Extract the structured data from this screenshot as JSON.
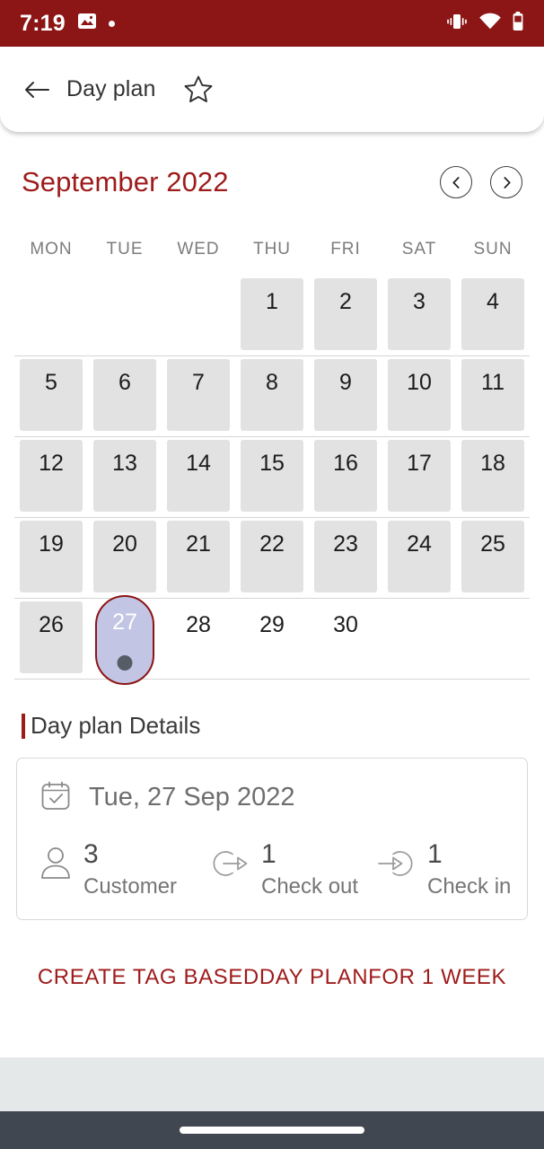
{
  "status_bar": {
    "time": "7:19",
    "icons": [
      "image-icon",
      "notification-dot",
      "vibrate-icon",
      "wifi-icon",
      "battery-icon"
    ],
    "background_color": "#8C1515"
  },
  "app_bar": {
    "back_icon": "arrow-left-icon",
    "title": "Day plan",
    "star_icon": "star-outline-icon"
  },
  "calendar": {
    "month_title": "September 2022",
    "prev_icon": "chevron-left-icon",
    "next_icon": "chevron-right-icon",
    "weekdays": [
      "MON",
      "TUE",
      "WED",
      "THU",
      "FRI",
      "SAT",
      "SUN"
    ],
    "accent_color": "#9E1B1B",
    "selected_day": 27,
    "weeks": [
      [
        {
          "day": "",
          "state": "blank"
        },
        {
          "day": "",
          "state": "blank"
        },
        {
          "day": "",
          "state": "blank"
        },
        {
          "day": "1",
          "state": "past"
        },
        {
          "day": "2",
          "state": "past"
        },
        {
          "day": "3",
          "state": "past"
        },
        {
          "day": "4",
          "state": "past"
        }
      ],
      [
        {
          "day": "5",
          "state": "past"
        },
        {
          "day": "6",
          "state": "past"
        },
        {
          "day": "7",
          "state": "past"
        },
        {
          "day": "8",
          "state": "past"
        },
        {
          "day": "9",
          "state": "past"
        },
        {
          "day": "10",
          "state": "past"
        },
        {
          "day": "11",
          "state": "past"
        }
      ],
      [
        {
          "day": "12",
          "state": "past"
        },
        {
          "day": "13",
          "state": "past"
        },
        {
          "day": "14",
          "state": "past"
        },
        {
          "day": "15",
          "state": "past"
        },
        {
          "day": "16",
          "state": "past"
        },
        {
          "day": "17",
          "state": "past"
        },
        {
          "day": "18",
          "state": "past"
        }
      ],
      [
        {
          "day": "19",
          "state": "past"
        },
        {
          "day": "20",
          "state": "past"
        },
        {
          "day": "21",
          "state": "past"
        },
        {
          "day": "22",
          "state": "past"
        },
        {
          "day": "23",
          "state": "past"
        },
        {
          "day": "24",
          "state": "past"
        },
        {
          "day": "25",
          "state": "past"
        }
      ],
      [
        {
          "day": "26",
          "state": "past"
        },
        {
          "day": "27",
          "state": "selected",
          "has_event": true
        },
        {
          "day": "28",
          "state": "future"
        },
        {
          "day": "29",
          "state": "future"
        },
        {
          "day": "30",
          "state": "future"
        },
        {
          "day": "",
          "state": "blank"
        },
        {
          "day": "",
          "state": "blank"
        }
      ]
    ]
  },
  "details": {
    "section_title": "Day plan Details",
    "date_icon": "calendar-check-icon",
    "date_text": "Tue, 27 Sep 2022",
    "stats": [
      {
        "icon": "person-icon",
        "value": "3",
        "label": "Customer"
      },
      {
        "icon": "check-out-icon",
        "value": "1",
        "label": "Check out"
      },
      {
        "icon": "check-in-icon",
        "value": "1",
        "label": "Check in"
      }
    ]
  },
  "cta": {
    "label": "CREATE TAG BASEDDAY PLANFOR 1 WEEK",
    "color": "#9E1B1B"
  },
  "system_nav": {
    "home_pill": "home-indicator"
  }
}
